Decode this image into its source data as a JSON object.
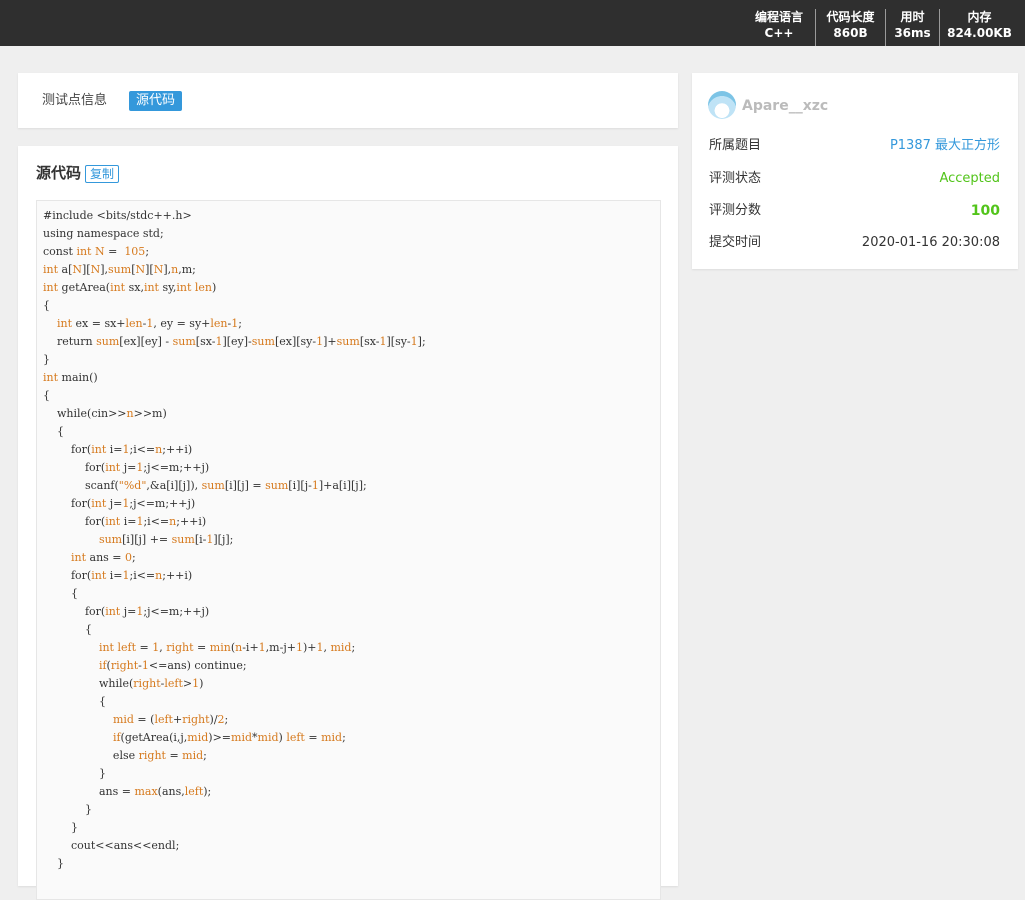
{
  "topbar": {
    "stats": [
      {
        "label": "编程语言",
        "value": "C++"
      },
      {
        "label": "代码长度",
        "value": "860B"
      },
      {
        "label": "用时",
        "value": "36ms"
      },
      {
        "label": "内存",
        "value": "824.00KB"
      }
    ]
  },
  "tabs": {
    "info": "测试点信息",
    "source": "源代码"
  },
  "code_section": {
    "title": "源代码",
    "copy_label": "复制"
  },
  "submission": {
    "username": "Apare__xzc",
    "rows": [
      {
        "label": "所属题目",
        "value": "P1387 最大正方形"
      },
      {
        "label": "评测状态",
        "value": "Accepted"
      },
      {
        "label": "评测分数",
        "value": "100"
      },
      {
        "label": "提交时间",
        "value": "2020-01-16 20:30:08"
      }
    ]
  },
  "colors": {
    "topbar": "#2f2f2f",
    "accent": "#3498db",
    "accepted": "#52c41a",
    "keyword": "#d67a1e"
  },
  "source_code": "#include <bits/stdc++.h>\nusing namespace std;\nconst int N =  105;\nint a[N][N],sum[N][N],n,m;\nint getArea(int sx,int sy,int len)\n{\n    int ex = sx+len-1, ey = sy+len-1;\n    return sum[ex][ey] - sum[sx-1][ey]-sum[ex][sy-1]+sum[sx-1][sy-1];\n}\nint main()\n{\n    while(cin>>n>>m)\n    {\n        for(int i=1;i<=n;++i)\n            for(int j=1;j<=m;++j)\n            scanf(\"%d\",&a[i][j]), sum[i][j] = sum[i][j-1]+a[i][j];\n        for(int j=1;j<=m;++j)\n            for(int i=1;i<=n;++i)\n                sum[i][j] += sum[i-1][j];\n        int ans = 0;\n        for(int i=1;i<=n;++i)\n        {\n            for(int j=1;j<=m;++j)\n            {\n                int left = 1, right = min(n-i+1,m-j+1)+1, mid;\n                if(right-1<=ans) continue;\n                while(right-left>1)\n                {\n                    mid = (left+right)/2;\n                    if(getArea(i,j,mid)>=mid*mid) left = mid;\n                    else right = mid;\n                }\n                ans = max(ans,left);\n            }\n        }\n        cout<<ans<<endl;\n    }"
}
